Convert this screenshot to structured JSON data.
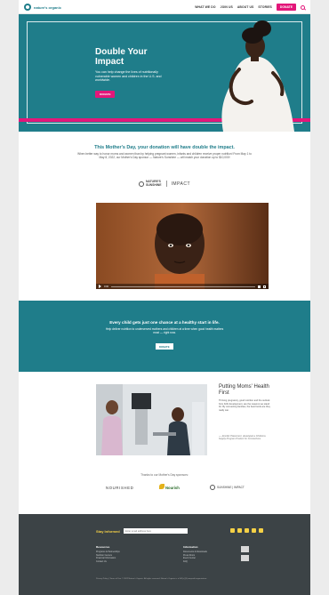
{
  "brand": {
    "name": "nature's organic"
  },
  "nav": {
    "items": [
      "WHAT WE DO",
      "JOIN US",
      "ABOUT US",
      "STORIES"
    ],
    "donate_label": "DONATE"
  },
  "hero": {
    "title": "Double Your Impact",
    "subtitle": "You can help change the lives of nutritionally vulnerable women and children in the U.S. and worldwide.",
    "cta": "DONATE"
  },
  "intro": {
    "title": "This Mother's Day, your donation will have double the impact.",
    "body": "When better way to honor moms and women than by helping pregnant women, infants and children receive proper nutrition! From May 1 to May 8, 2022, our Mother's Day sponsor — Nature's Sunshine — will match your donation up to $10,000!"
  },
  "partners": {
    "ns_line1": "NATURE'S",
    "ns_line2": "SUNSHINE",
    "impact": "IMPACT"
  },
  "video": {
    "time": "0:00"
  },
  "band": {
    "title": "Every child gets just one chance at a healthy start in life.",
    "body": "Help deliver nutrition to underserved mothers and children at a time when good health matters most — right now.",
    "cta": "DONATE"
  },
  "feature": {
    "title": "Putting Moms' Health First",
    "body": "Thriving pregnancy, good nutrition and the outlook from birth development, are the reasons we stand for. By connecting families, the best foods are they really can.",
    "quote": "— Jennifer Placement, developed a Childrens Supply Program Product for Connections"
  },
  "sponsors": {
    "thanks": "Thanks to our Mother's Day sponsors:",
    "nourished": "NOURISHED",
    "nm": "Nourish",
    "ns": "SUNSHINE | IMPACT"
  },
  "footer": {
    "stay": "Stay Informed",
    "email_placeholder": "Enter email address here",
    "col_a_title": "Resources",
    "col_a": [
      "Programs & Partnerships",
      "Nutrition Centers",
      "Financial Information",
      "Contact Us"
    ],
    "col_b_title": "Information",
    "col_b": [
      "Documents & Downloads",
      "Press Room",
      "Event Center",
      "FAQ"
    ],
    "legal": "Privacy Policy | Terms of Use\n© 2022 Nature's Organic. All rights reserved. Nature's Organic is a 501(c)(3) nonprofit organization."
  }
}
